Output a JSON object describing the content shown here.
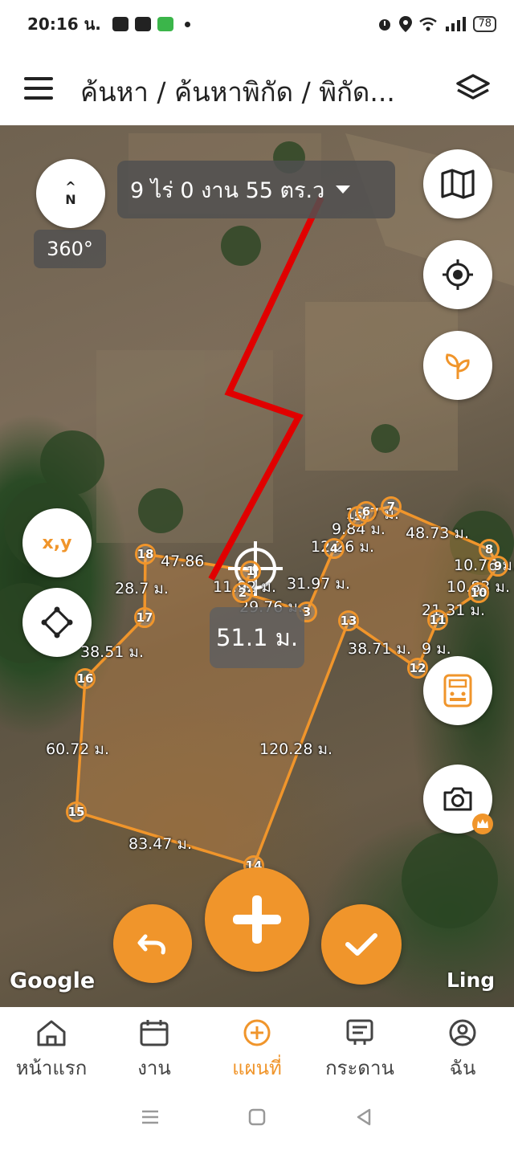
{
  "status_bar": {
    "time": "20:16 น.",
    "battery": "78"
  },
  "app_bar": {
    "title": "ค้นหา / ค้นหาพิกัด / พิกัด..."
  },
  "map": {
    "compass_label": "N",
    "rotation": "360°",
    "area_summary": "9 ไร่ 0 งาน 55 ตร.ว",
    "current_distance": "51.1 ม.",
    "xy_button": "x,y",
    "attribution": "Google",
    "watermark": "Ling",
    "edge_labels": [
      "47.86",
      "28.7 ม.",
      "38.51 ม.",
      "60.72 ม.",
      "83.47 ม.",
      "120.28 ม.",
      "38.71 ม.",
      "9 ม.",
      "21.31 ม.",
      "10.83 ม.",
      "10.76 ม.",
      "48.73 ม.",
      "1.77 ม.",
      "9.84 ม.",
      "12.26 ม.",
      "31.97 ม.",
      "29.76 ม.",
      "11.92 ม."
    ],
    "vertices": [
      "1",
      "2",
      "3",
      "4",
      "5",
      "6",
      "7",
      "8",
      "9",
      "10",
      "11",
      "12",
      "13",
      "14",
      "15",
      "16",
      "17",
      "18"
    ],
    "colors": {
      "accent": "#f0952b",
      "track": "#e00000"
    }
  },
  "bottom_nav": {
    "items": [
      {
        "label": "หน้าแรก"
      },
      {
        "label": "งาน"
      },
      {
        "label": "แผนที่"
      },
      {
        "label": "กระดาน"
      },
      {
        "label": "ฉัน"
      }
    ],
    "active_index": 2
  }
}
